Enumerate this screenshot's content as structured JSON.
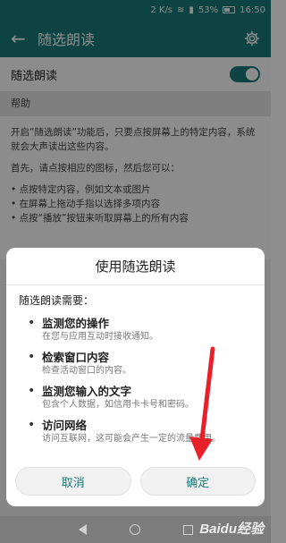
{
  "statusbar": {
    "network": "2 K/s",
    "battery": "53%",
    "time": "16:50"
  },
  "appbar": {
    "title": "随选朗读"
  },
  "toggle_row": {
    "label": "随选朗读",
    "enabled": true
  },
  "help": {
    "section_title": "帮助",
    "paragraph1": "开启“随选朗读”功能后，只要点按屏幕上的特定内容，系统就会大声读出这些内容。",
    "paragraph2": "首先，请点按相应的图标，然后您可以：",
    "bullets": [
      "• 点按特定内容，例如文本或图片",
      "• 在屏幕上拖动手指以选择多项内容",
      "• 点按“播放”按钮来听取屏幕上的所有内容"
    ]
  },
  "dialog": {
    "title": "使用随选朗读",
    "intro": "随选朗读需要：",
    "permissions": [
      {
        "title": "监测您的操作",
        "desc": "在您与应用互动时接收通知。"
      },
      {
        "title": "检索窗口内容",
        "desc": "检查活动窗口的内容。"
      },
      {
        "title": "监测您输入的文字",
        "desc": "包含个人数据，如信用卡卡号和密码。"
      },
      {
        "title": "访问网络",
        "desc": "访问互联网，这可能会产生一定的流量费用。"
      }
    ],
    "cancel_label": "取消",
    "ok_label": "确定"
  },
  "watermark": "Baidu经验",
  "colors": {
    "accent": "#197a78",
    "annotation": "#e8202a"
  }
}
